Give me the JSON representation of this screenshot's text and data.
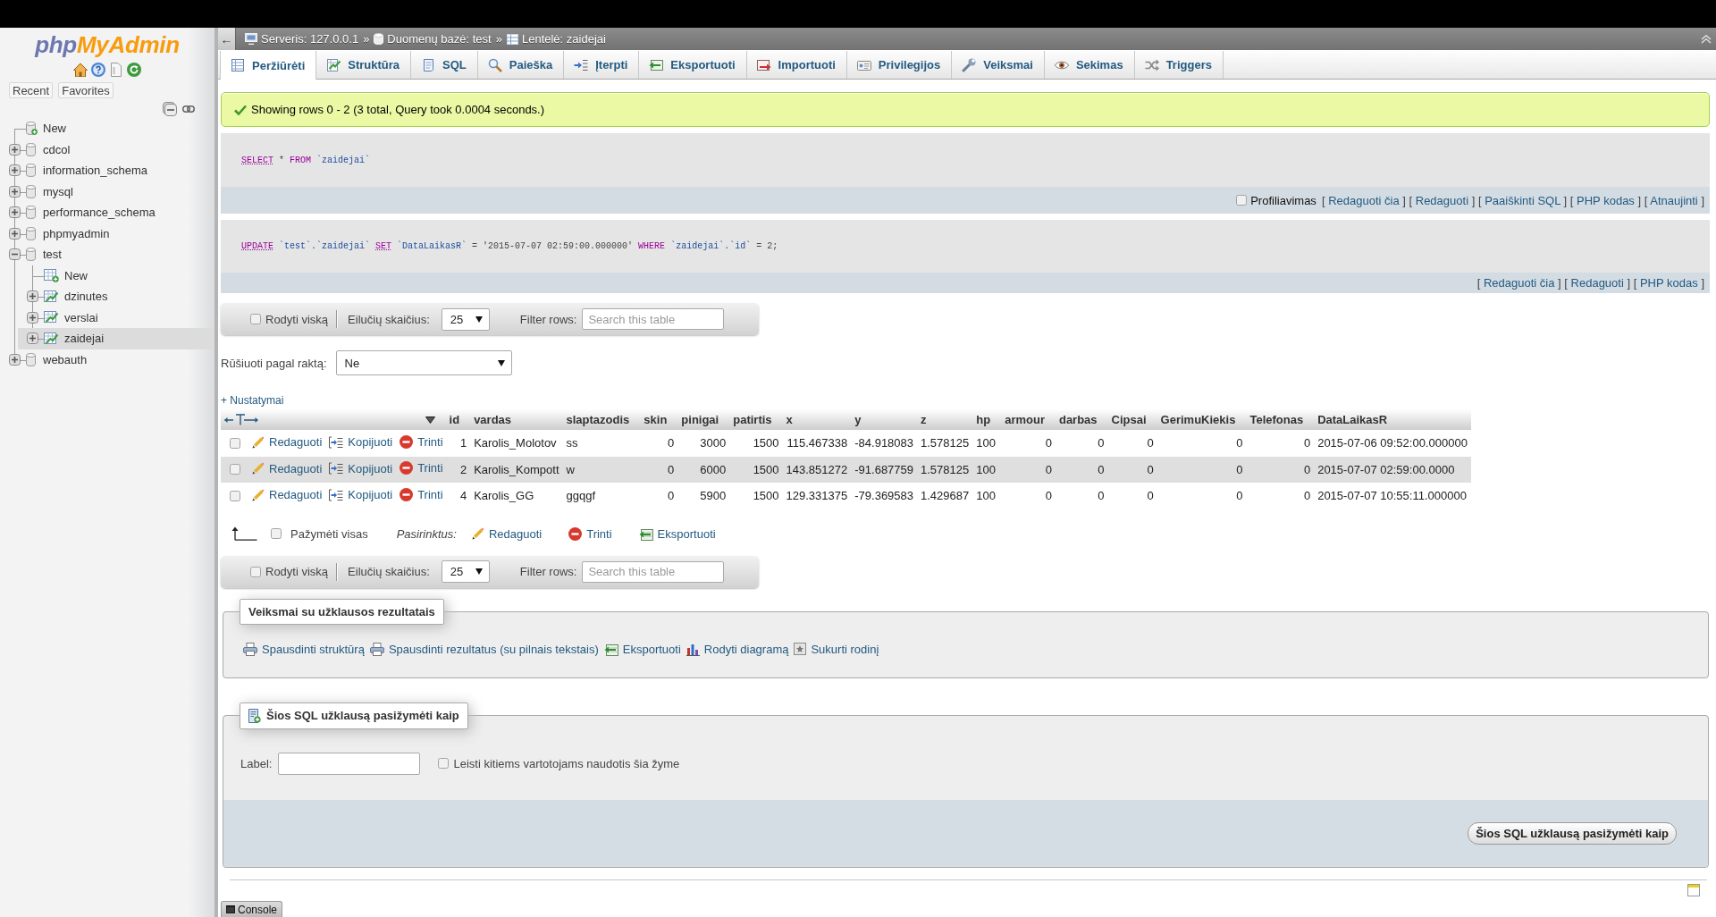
{
  "sidebar": {
    "logo": {
      "prefix": "php",
      "name": "MyAdmin"
    },
    "tabs": [
      {
        "label": "Recent"
      },
      {
        "label": "Favorites"
      }
    ],
    "tree": [
      {
        "kind": "new",
        "label": "New",
        "selected": false
      },
      {
        "kind": "database",
        "label": "cdcol",
        "expanded": false,
        "selected": false
      },
      {
        "kind": "database",
        "label": "information_schema",
        "expanded": false,
        "selected": false
      },
      {
        "kind": "database",
        "label": "mysql",
        "expanded": false,
        "selected": false
      },
      {
        "kind": "database",
        "label": "performance_schema",
        "expanded": false,
        "selected": false
      },
      {
        "kind": "database",
        "label": "phpmyadmin",
        "expanded": false,
        "selected": false
      },
      {
        "kind": "database",
        "label": "test",
        "expanded": true,
        "selected": false,
        "children": [
          {
            "kind": "new",
            "label": "New",
            "selected": false
          },
          {
            "kind": "table",
            "label": "dzinutes",
            "expanded": false,
            "selected": false
          },
          {
            "kind": "table",
            "label": "verslai",
            "expanded": false,
            "selected": false
          },
          {
            "kind": "table",
            "label": "zaidejai",
            "expanded": false,
            "selected": true
          }
        ]
      },
      {
        "kind": "database",
        "label": "webauth",
        "expanded": false,
        "selected": false
      }
    ]
  },
  "breadcrumb": {
    "back": "←",
    "items": [
      {
        "label": "Serveris: 127.0.0.1",
        "separator": "»"
      },
      {
        "label": "Duomenų bazė: test",
        "separator": "»"
      },
      {
        "label": "Lentelė: zaidejai"
      }
    ]
  },
  "tabs": [
    {
      "label": "Peržiūrėti",
      "selected": true
    },
    {
      "label": "Struktūra",
      "selected": false
    },
    {
      "label": "SQL",
      "selected": false
    },
    {
      "label": "Paieška",
      "selected": false
    },
    {
      "label": "Įterpti",
      "selected": false
    },
    {
      "label": "Eksportuoti",
      "selected": false
    },
    {
      "label": "Importuoti",
      "selected": false
    },
    {
      "label": "Privilegijos",
      "selected": false
    },
    {
      "label": "Veiksmai",
      "selected": false
    },
    {
      "label": "Sekimas",
      "selected": false
    },
    {
      "label": "Triggers",
      "selected": false
    }
  ],
  "message": "Showing rows 0 - 2 (3 total, Query took 0.0004 seconds.)",
  "queries": [
    {
      "tokens": [
        {
          "text": "SELECT",
          "kind": "link"
        },
        {
          "text": " * ",
          "kind": "plain"
        },
        {
          "text": "FROM",
          "kind": "keyword"
        },
        {
          "text": " `zaidejai`",
          "kind": "identifier"
        }
      ],
      "profiling": {
        "label": "Profiliavimas",
        "checked": false
      },
      "links": [
        {
          "open": "[",
          "label": "Redaguoti čia",
          "close": "]"
        },
        {
          "open": "[",
          "label": "Redaguoti",
          "close": "]"
        },
        {
          "open": "[",
          "label": "Paaiškinti SQL",
          "close": "]"
        },
        {
          "open": "[",
          "label": "PHP kodas",
          "close": "]"
        },
        {
          "open": "[",
          "label": "Atnaujinti",
          "close": "]"
        }
      ]
    },
    {
      "tokens": [
        {
          "text": "UPDATE",
          "kind": "link"
        },
        {
          "text": " `test`.`zaidejai` ",
          "kind": "identifier"
        },
        {
          "text": "SET",
          "kind": "link"
        },
        {
          "text": " `DataLaikasR` ",
          "kind": "identifier"
        },
        {
          "text": "= '2015-07-07 02:59:00.000000' ",
          "kind": "plain"
        },
        {
          "text": "WHERE",
          "kind": "keyword"
        },
        {
          "text": " `zaidejai`.`id` ",
          "kind": "identifier"
        },
        {
          "text": "= 2;",
          "kind": "plain"
        }
      ],
      "links": [
        {
          "open": "[",
          "label": "Redaguoti čia",
          "close": "]"
        },
        {
          "open": "[",
          "label": "Redaguoti",
          "close": "]"
        },
        {
          "open": "[",
          "label": "PHP kodas",
          "close": "]"
        }
      ]
    }
  ],
  "navigation_top": {
    "show_all": {
      "label": "Rodyti viską",
      "checked": false
    },
    "rows_label": "Eilučių skaičius:",
    "rows_value": "25",
    "filter_label": "Filter rows:",
    "filter_placeholder": "Search this table"
  },
  "sort": {
    "label": "Rūšiuoti pagal raktą:",
    "value": "Ne"
  },
  "options_link": "+ Nustatymai",
  "table": {
    "columns": [
      {
        "label": "id",
        "kind": "number"
      },
      {
        "label": "vardas",
        "kind": "text"
      },
      {
        "label": "slaptazodis",
        "kind": "text"
      },
      {
        "label": "skin",
        "kind": "number"
      },
      {
        "label": "pinigai",
        "kind": "number"
      },
      {
        "label": "patirtis",
        "kind": "number"
      },
      {
        "label": "x",
        "kind": "number"
      },
      {
        "label": "y",
        "kind": "number"
      },
      {
        "label": "z",
        "kind": "number"
      },
      {
        "label": "hp",
        "kind": "text"
      },
      {
        "label": "armour",
        "kind": "number"
      },
      {
        "label": "darbas",
        "kind": "number"
      },
      {
        "label": "Cipsai",
        "kind": "number"
      },
      {
        "label": "GerimuKiekis",
        "kind": "number"
      },
      {
        "label": "Telefonas",
        "kind": "number"
      },
      {
        "label": "DataLaikasR",
        "kind": "text"
      }
    ],
    "rows": [
      {
        "checked": false,
        "actions": [
          {
            "kind": "edit",
            "label": "Redaguoti"
          },
          {
            "kind": "copy",
            "label": "Kopijuoti"
          },
          {
            "kind": "delete",
            "label": "Trinti"
          }
        ],
        "cells": [
          "1",
          "Karolis_Molotov",
          "ss",
          "0",
          "3000",
          "1500",
          "115.467338",
          "-84.918083",
          "1.578125",
          "100",
          "0",
          "0",
          "0",
          "0",
          "0",
          "2015-07-06 09:52:00.000000"
        ]
      },
      {
        "checked": false,
        "actions": [
          {
            "kind": "edit",
            "label": "Redaguoti"
          },
          {
            "kind": "copy",
            "label": "Kopijuoti"
          },
          {
            "kind": "delete",
            "label": "Trinti"
          }
        ],
        "cells": [
          "2",
          "Karolis_Kompott",
          "w",
          "0",
          "6000",
          "1500",
          "143.851272",
          "-91.687759",
          "1.578125",
          "100",
          "0",
          "0",
          "0",
          "0",
          "0",
          "2015-07-07 02:59:00.0000"
        ]
      },
      {
        "checked": false,
        "actions": [
          {
            "kind": "edit",
            "label": "Redaguoti"
          },
          {
            "kind": "copy",
            "label": "Kopijuoti"
          },
          {
            "kind": "delete",
            "label": "Trinti"
          }
        ],
        "cells": [
          "4",
          "Karolis_GG",
          "ggqgf",
          "0",
          "5900",
          "1500",
          "129.331375",
          "-79.369583",
          "1.429687",
          "100",
          "0",
          "0",
          "0",
          "0",
          "0",
          "2015-07-07 10:55:11.000000"
        ]
      }
    ]
  },
  "bulk": {
    "check_all": {
      "label": "Pažymėti visas",
      "checked": false
    },
    "with_selected": "Pasirinktus:",
    "actions": [
      {
        "kind": "edit",
        "label": "Redaguoti"
      },
      {
        "kind": "delete",
        "label": "Trinti"
      },
      {
        "kind": "export",
        "label": "Eksportuoti"
      }
    ]
  },
  "navigation_bottom": {
    "show_all": {
      "label": "Rodyti viską",
      "checked": false
    },
    "rows_label": "Eilučių skaičius:",
    "rows_value": "25",
    "filter_label": "Filter rows:",
    "filter_placeholder": "Search this table"
  },
  "query_operations": {
    "legend": "Veiksmai su užklausos rezultatais",
    "links": [
      {
        "kind": "print",
        "label": "Spausdinti struktūrą"
      },
      {
        "kind": "print",
        "label": "Spausdinti rezultatus (su pilnais tekstais)"
      },
      {
        "kind": "export",
        "label": "Eksportuoti"
      },
      {
        "kind": "chart",
        "label": "Rodyti diagramą"
      },
      {
        "kind": "view",
        "label": "Sukurti rodinį"
      }
    ]
  },
  "bookmark": {
    "legend": "Šios SQL užklausą pasižymėti kaip",
    "field_label": "Label:",
    "shared": {
      "label": "Leisti kitiems vartotojams naudotis šia žyme",
      "checked": false
    },
    "button": "Šios SQL užklausą pasižymėti kaip"
  },
  "console": {
    "label": "Console"
  }
}
